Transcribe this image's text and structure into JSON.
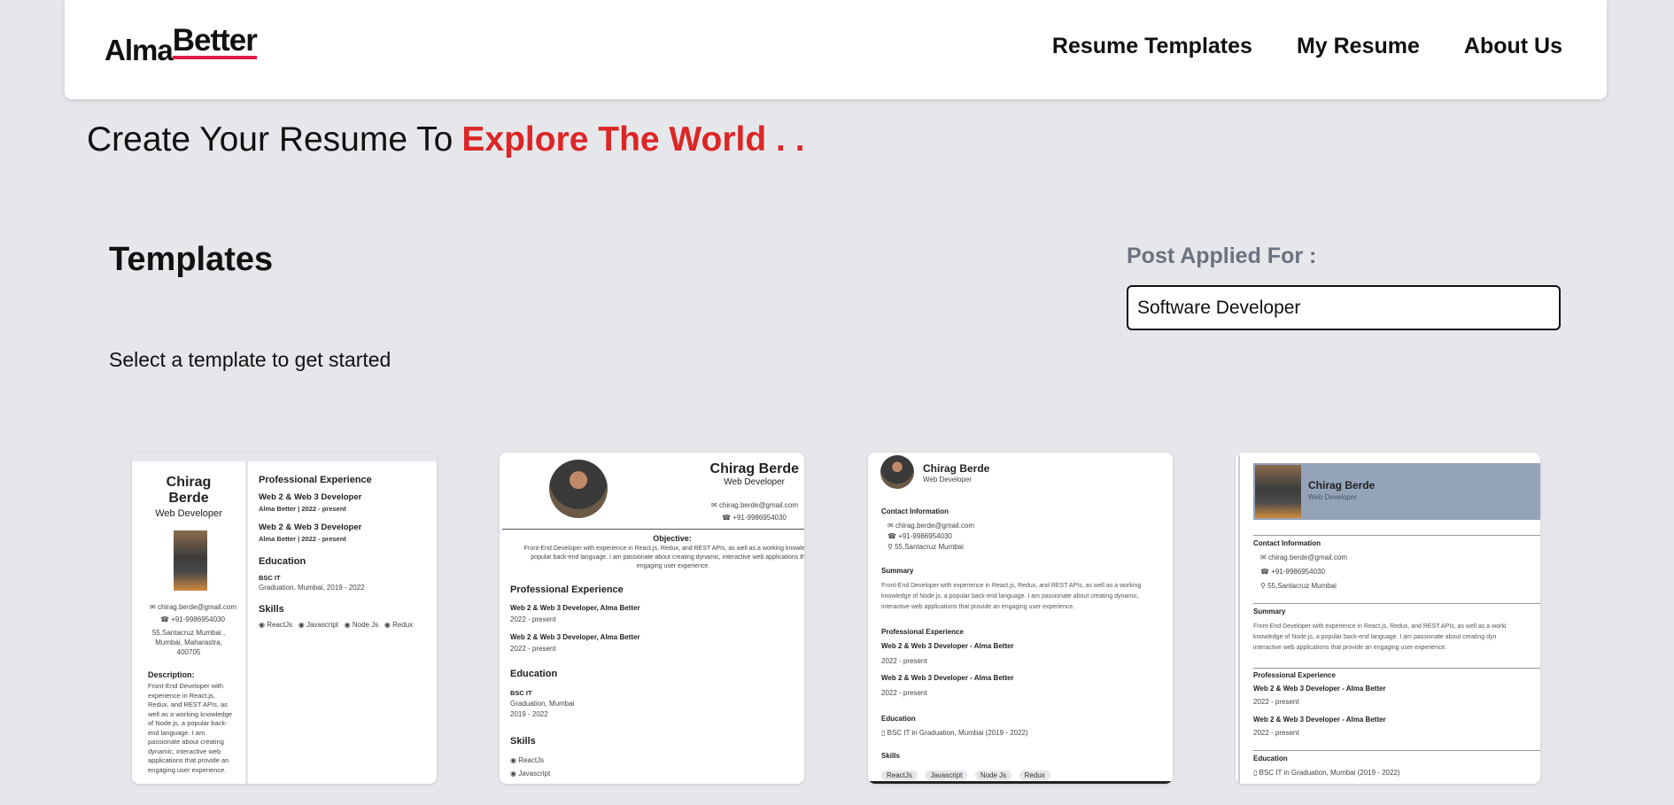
{
  "nav": {
    "logo_part1": "Alma",
    "logo_part2": "Better",
    "links": [
      "Resume Templates",
      "My Resume",
      "About Us"
    ]
  },
  "hero": {
    "text": "Create Your Resume To",
    "accent": "Explore The World . ."
  },
  "templates_section": {
    "title": "Templates",
    "subtitle": "Select a template to get started"
  },
  "post": {
    "label": "Post Applied For :",
    "value": "Software Developer"
  },
  "colors": {
    "background": "#e5e7eb",
    "accent": "#dc2626",
    "label_gray": "#6b7280",
    "template4_header": "#94a3b8"
  },
  "resume": {
    "first_name": "Chirag",
    "last_name": "Berde",
    "full_name": "Chirag Berde",
    "role": "Web Developer",
    "email": "chirag.berde@gmail.com",
    "phone": "+91-9986954030",
    "address_short": "55,Santacruz Mumbai",
    "address_line1": "55,Santacruz Mumbai ,",
    "address_line2": "Mumbai, Maharastra,",
    "address_line3": "400705",
    "job_title": "Web 2 & Web 3 Developer",
    "company_line": "Alma Better | 2022 - present",
    "job_with_company": "Web 2 & Web 3 Developer, Alma Better",
    "job_dash_company": "Web 2 & Web 3 Developer - Alma Better",
    "period": "2022 - present",
    "degree": "BSC IT",
    "edu_line": "Graduation, Mumbai, 2019 - 2022",
    "edu_place": "Graduation, Mumbai",
    "edu_years": "2019 - 2022",
    "edu_full": "BSC IT in Graduation, Mumbai (2019 - 2022)",
    "skills": [
      "ReactJs",
      "Javascript",
      "Node Js",
      "Redux"
    ],
    "headings": {
      "prof_exp": "Professional Experience",
      "education": "Education",
      "skills": "Skills",
      "description": "Description:",
      "objective": "Objective:",
      "contact": "Contact Information",
      "summary": "Summary"
    },
    "desc_lines": [
      "Front-End Developer with",
      "experience in React.js,",
      "Redux, and REST APIs, as",
      "well as a working knowledge",
      "of Node.js, a popular back-",
      "end language. I am",
      "passionate about creating",
      "dynamic, interactive web",
      "applications that provide an",
      "engaging user experience."
    ],
    "objective_lines": [
      "Front-End Developer with experience in React.js, Redux, and REST APIs, as well as a working knowledge of",
      "popular back-end language. I am passionate about creating dynamic, interactive web applications that p",
      "engaging user experience."
    ],
    "summary_lines": [
      "Front-End Developer with experience in React.js, Redux, and REST APIs, as well as a working",
      "knowledge of Node.js, a popular back-end language. I am passionate about creating dynamic,",
      "interactive web applications that provide an engaging user experience."
    ],
    "summary_lines_b": [
      "Front-End Developer with experience in React.js, Redux, and REST APIs, as well as a worki",
      "knowledge of Node.js, a popular back-end language. I am passionate about creating dyn",
      "interactive web applications that provide an engaging user experience."
    ]
  }
}
